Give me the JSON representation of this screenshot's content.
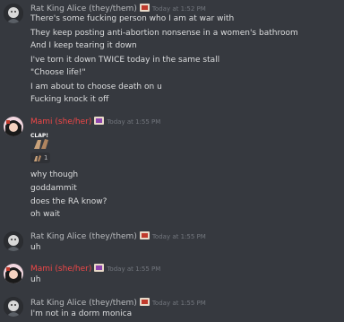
{
  "messages": [
    {
      "author": "Rat King Alice (they/them)",
      "timestamp": "Today at 1:52 PM",
      "lines": [
        "There's some fucking person who I am at war with",
        "They keep posting anti-abortion nonsense in a women's bathroom",
        "And I keep tearing it down",
        "I've torn it down TWICE today in the same stall",
        "\"Choose life!\"",
        "I am about to choose death on u",
        "Fucking knock it off"
      ]
    },
    {
      "author": "Mami (she/her)",
      "timestamp": "Today at 1:55 PM",
      "emoji_label": "CLAP!",
      "reaction_count": "1",
      "lines": [
        "why though",
        "goddammit",
        "does the RA know?",
        "oh wait"
      ]
    },
    {
      "author": "Rat King Alice (they/them)",
      "timestamp": "Today at 1:55 PM",
      "lines": [
        "uh"
      ]
    },
    {
      "author": "Mami (she/her)",
      "timestamp": "Today at 1:55 PM",
      "lines": [
        "uh"
      ]
    },
    {
      "author": "Rat King Alice (they/them)",
      "timestamp": "Today at 1:55 PM",
      "lines": [
        "I'm not in a dorm monica"
      ]
    }
  ],
  "colors": {
    "background": "#36393f",
    "text": "#dcddde",
    "author_alice": "#b9bbbe",
    "author_mami": "#f04747",
    "timestamp": "#72767d"
  }
}
